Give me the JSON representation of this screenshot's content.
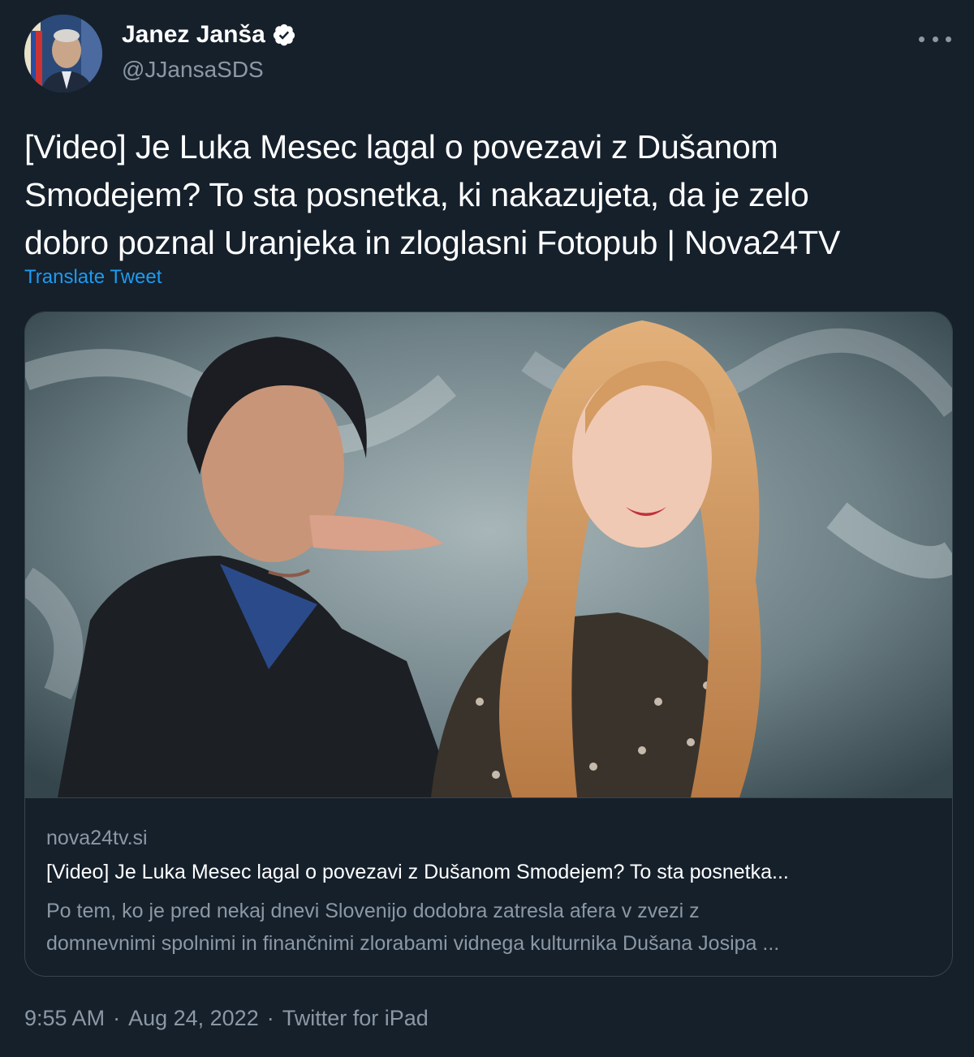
{
  "author": {
    "display_name": "Janez Janša",
    "handle": "@JJansaSDS",
    "verified_icon": "verified-badge-icon",
    "more_icon": "more-options-icon"
  },
  "tweet": {
    "lines": [
      "[Video] Je Luka Mesec lagal o povezavi z Dušanom",
      "Smodejem? To sta posnetka, ki nakazujeta, da je zelo",
      "dobro poznal Uranjeka in zloglasni Fotopub | Nova24TV"
    ],
    "translate_label": "Translate Tweet"
  },
  "card": {
    "domain": "nova24tv.si",
    "title": "[Video] Je Luka Mesec lagal o povezavi z Dušanom Smodejem? To sta posnetka...",
    "description_lines": [
      "Po tem, ko je pred nekaj dnevi Slovenijo dodobra zatresla afera v zvezi z",
      "domnevnimi spolnimi in finančnimi zlorabami vidnega kulturnika Dušana Josipa ..."
    ]
  },
  "meta": {
    "time": "9:55 AM",
    "date": "Aug 24, 2022",
    "separator": "·",
    "source": "Twitter for iPad"
  },
  "colors": {
    "background": "#15202b",
    "link": "#1d9bf0",
    "secondary_text": "#8b98a5",
    "border": "#38444d"
  }
}
